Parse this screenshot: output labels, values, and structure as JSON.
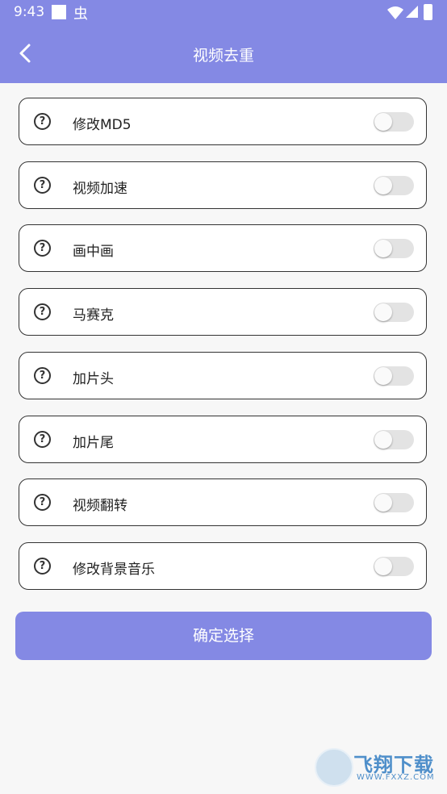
{
  "status_bar": {
    "time": "9:43",
    "bug_glyph": "虫"
  },
  "header": {
    "title": "视频去重",
    "back_icon": "chevron-left-icon"
  },
  "options": [
    {
      "label": "修改MD5",
      "enabled": false
    },
    {
      "label": "视频加速",
      "enabled": false
    },
    {
      "label": "画中画",
      "enabled": false
    },
    {
      "label": "马赛克",
      "enabled": false
    },
    {
      "label": "加片头",
      "enabled": false
    },
    {
      "label": "加片尾",
      "enabled": false
    },
    {
      "label": "视频翻转",
      "enabled": false
    },
    {
      "label": "修改背景音乐",
      "enabled": false
    }
  ],
  "help_glyph": "?",
  "confirm_button": {
    "label": "确定选择"
  },
  "watermark": {
    "text": "飞翔下载",
    "url": "WWW.FXXZ.COM"
  },
  "colors": {
    "accent": "#8489e4",
    "toggle_off": "#e3e3e3",
    "border": "#333333"
  }
}
